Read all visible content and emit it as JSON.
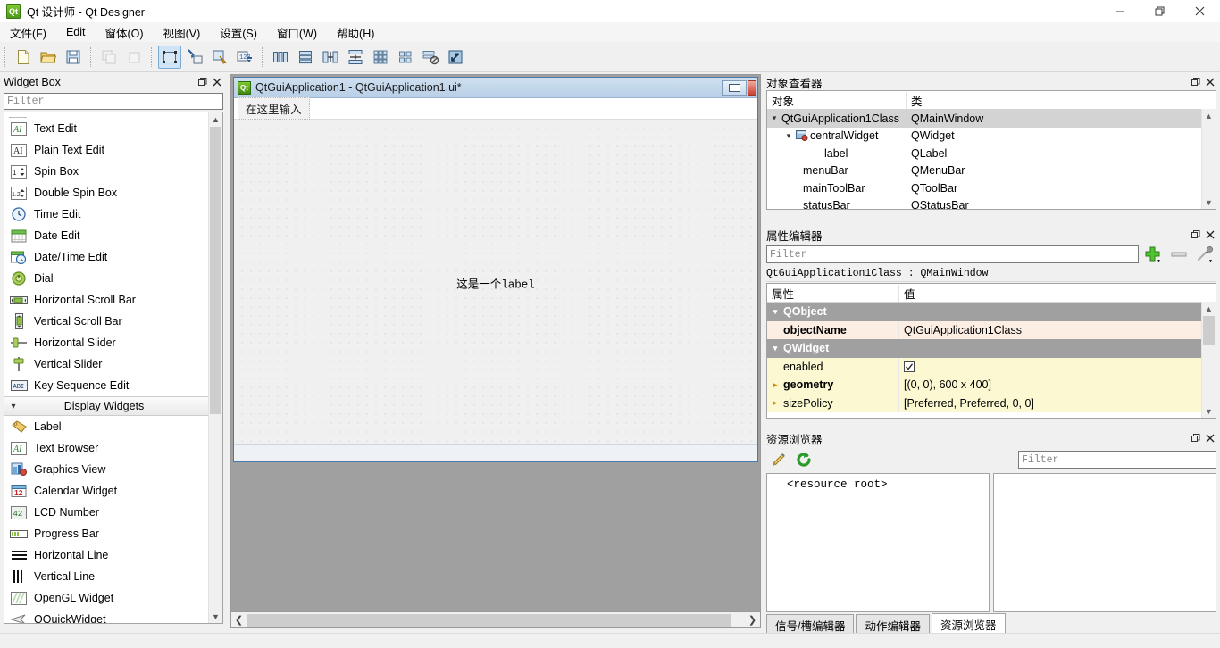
{
  "window": {
    "title": "Qt 设计师 - Qt Designer",
    "app_icon": "qt-logo-icon",
    "controls": {
      "minimize": "minimize-icon",
      "restore": "restore-icon",
      "close": "close-icon"
    }
  },
  "menubar": {
    "items": [
      {
        "label": "文件(F)"
      },
      {
        "label": "Edit"
      },
      {
        "label": "窗体(O)"
      },
      {
        "label": "视图(V)"
      },
      {
        "label": "设置(S)"
      },
      {
        "label": "窗口(W)"
      },
      {
        "label": "帮助(H)"
      }
    ]
  },
  "toolbar": {
    "groups": [
      {
        "buttons": [
          {
            "name": "new-form-button",
            "icon": "new-file-icon",
            "state": "enabled"
          },
          {
            "name": "open-form-button",
            "icon": "open-folder-icon",
            "state": "enabled"
          },
          {
            "name": "save-form-button",
            "icon": "save-disk-icon",
            "state": "enabled"
          }
        ]
      },
      {
        "buttons": [
          {
            "name": "undo-button",
            "icon": "undo-icon",
            "state": "disabled"
          },
          {
            "name": "redo-button",
            "icon": "redo-icon",
            "state": "disabled"
          }
        ]
      },
      {
        "buttons": [
          {
            "name": "edit-widgets-button",
            "icon": "edit-widgets-icon",
            "state": "active"
          },
          {
            "name": "edit-signals-slots-button",
            "icon": "signals-slots-icon",
            "state": "enabled"
          },
          {
            "name": "edit-buddies-button",
            "icon": "buddies-icon",
            "state": "enabled"
          },
          {
            "name": "edit-tab-order-button",
            "icon": "tab-order-icon",
            "state": "enabled"
          }
        ]
      },
      {
        "buttons": [
          {
            "name": "layout-horizontally-button",
            "icon": "layout-horizontal-icon",
            "state": "enabled"
          },
          {
            "name": "layout-vertically-button",
            "icon": "layout-vertical-icon",
            "state": "enabled"
          },
          {
            "name": "layout-splitter-horizontal-button",
            "icon": "splitter-horizontal-icon",
            "state": "enabled"
          },
          {
            "name": "layout-splitter-vertical-button",
            "icon": "splitter-vertical-icon",
            "state": "enabled"
          },
          {
            "name": "layout-grid-button",
            "icon": "layout-grid-icon",
            "state": "enabled"
          },
          {
            "name": "layout-form-button",
            "icon": "layout-form-icon",
            "state": "enabled"
          },
          {
            "name": "break-layout-button",
            "icon": "break-layout-icon",
            "state": "enabled"
          },
          {
            "name": "adjust-size-button",
            "icon": "adjust-size-icon",
            "state": "enabled"
          }
        ]
      }
    ]
  },
  "widget_box": {
    "title": "Widget Box",
    "float_button": "float-icon",
    "close_button": "close-icon",
    "filter": {
      "placeholder": "Filter",
      "value": ""
    },
    "items": [
      {
        "label": "Text Edit",
        "icon": "text-edit-icon"
      },
      {
        "label": "Plain Text Edit",
        "icon": "plain-text-edit-icon"
      },
      {
        "label": "Spin Box",
        "icon": "spin-box-icon"
      },
      {
        "label": "Double Spin Box",
        "icon": "double-spin-box-icon"
      },
      {
        "label": "Time Edit",
        "icon": "time-edit-icon"
      },
      {
        "label": "Date Edit",
        "icon": "date-edit-icon"
      },
      {
        "label": "Date/Time Edit",
        "icon": "date-time-edit-icon"
      },
      {
        "label": "Dial",
        "icon": "dial-icon"
      },
      {
        "label": "Horizontal Scroll Bar",
        "icon": "horizontal-scroll-bar-icon"
      },
      {
        "label": "Vertical Scroll Bar",
        "icon": "vertical-scroll-bar-icon"
      },
      {
        "label": "Horizontal Slider",
        "icon": "horizontal-slider-icon"
      },
      {
        "label": "Vertical Slider",
        "icon": "vertical-slider-icon"
      },
      {
        "label": "Key Sequence Edit",
        "icon": "key-sequence-edit-icon"
      }
    ],
    "category": {
      "label": "Display Widgets",
      "expanded": true
    },
    "display_items": [
      {
        "label": "Label",
        "icon": "label-icon"
      },
      {
        "label": "Text Browser",
        "icon": "text-browser-icon"
      },
      {
        "label": "Graphics View",
        "icon": "graphics-view-icon"
      },
      {
        "label": "Calendar Widget",
        "icon": "calendar-widget-icon"
      },
      {
        "label": "LCD Number",
        "icon": "lcd-number-icon"
      },
      {
        "label": "Progress Bar",
        "icon": "progress-bar-icon"
      },
      {
        "label": "Horizontal Line",
        "icon": "horizontal-line-icon"
      },
      {
        "label": "Vertical Line",
        "icon": "vertical-line-icon"
      },
      {
        "label": "OpenGL Widget",
        "icon": "opengl-widget-icon"
      },
      {
        "label": "QQuickWidget",
        "icon": "qquickwidget-icon"
      }
    ]
  },
  "form_window": {
    "title": "QtGuiApplication1 - QtGuiApplication1.ui*",
    "icon": "qt-logo-icon",
    "minimize_button": "minimize-icon",
    "close_button": "close-icon",
    "menu_placeholder": "在这里输入",
    "label_text": "这是一个label"
  },
  "object_inspector": {
    "title": "对象查看器",
    "float_button": "float-icon",
    "close_button": "close-icon",
    "columns": [
      "对象",
      "类"
    ],
    "rows": [
      {
        "object": "QtGuiApplication1Class",
        "class": "QMainWindow",
        "indent": 0,
        "expanded": true,
        "selected": true,
        "icon": ""
      },
      {
        "object": "centralWidget",
        "class": "QWidget",
        "indent": 1,
        "expanded": true,
        "selected": false,
        "icon": "central-widget-icon"
      },
      {
        "object": "label",
        "class": "QLabel",
        "indent": 2,
        "expanded": null,
        "selected": false,
        "icon": ""
      },
      {
        "object": "menuBar",
        "class": "QMenuBar",
        "indent": 1,
        "expanded": null,
        "selected": false,
        "icon": ""
      },
      {
        "object": "mainToolBar",
        "class": "QToolBar",
        "indent": 1,
        "expanded": null,
        "selected": false,
        "icon": ""
      },
      {
        "object": "statusBar",
        "class": "QStatusBar",
        "indent": 1,
        "expanded": null,
        "selected": false,
        "icon": ""
      }
    ]
  },
  "property_editor": {
    "title": "属性编辑器",
    "float_button": "float-icon",
    "close_button": "close-icon",
    "filter": {
      "placeholder": "Filter",
      "value": ""
    },
    "buttons": [
      {
        "name": "add-property-button",
        "icon": "plus-icon"
      },
      {
        "name": "remove-property-button",
        "icon": "minus-icon"
      },
      {
        "name": "configure-button",
        "icon": "wrench-icon"
      }
    ],
    "object_line": "QtGuiApplication1Class : QMainWindow",
    "columns": [
      "属性",
      "值"
    ],
    "rows": [
      {
        "kind": "group",
        "name": "QObject",
        "value": ""
      },
      {
        "kind": "prop",
        "name": "objectName",
        "value": "QtGuiApplication1Class",
        "bold": true,
        "style": "peach"
      },
      {
        "kind": "group",
        "name": "QWidget",
        "value": ""
      },
      {
        "kind": "prop",
        "name": "enabled",
        "value": "",
        "checkbox": true,
        "checked": true,
        "bold": false,
        "style": "yellow"
      },
      {
        "kind": "prop",
        "name": "geometry",
        "value": "[(0, 0), 600 x 400]",
        "bold": true,
        "expandable": true,
        "style": "yellow"
      },
      {
        "kind": "prop",
        "name": "sizePolicy",
        "value": "[Preferred, Preferred, 0, 0]",
        "bold": false,
        "expandable": true,
        "style": "yellow"
      }
    ]
  },
  "resource_browser": {
    "title": "资源浏览器",
    "float_button": "float-icon",
    "close_button": "close-icon",
    "buttons": [
      {
        "name": "edit-resources-button",
        "icon": "pencil-icon"
      },
      {
        "name": "reload-button",
        "icon": "reload-icon"
      }
    ],
    "filter": {
      "placeholder": "Filter",
      "value": ""
    },
    "tree_root": "<resource root>",
    "tabs": [
      {
        "label": "信号/槽编辑器",
        "active": false
      },
      {
        "label": "动作编辑器",
        "active": false
      },
      {
        "label": "资源浏览器",
        "active": true
      }
    ]
  },
  "colors": {
    "accent_blue": "#4b7aa8",
    "mdi_background": "#a0a0a0",
    "panel_background": "#f0f0f0",
    "property_group": "#a0a0a0",
    "property_peach": "#fdeee4",
    "property_yellow": "#fbf8d2",
    "selection": "#d3d3d3",
    "close_red": "#e81123",
    "qt_green": "#41cd52"
  }
}
